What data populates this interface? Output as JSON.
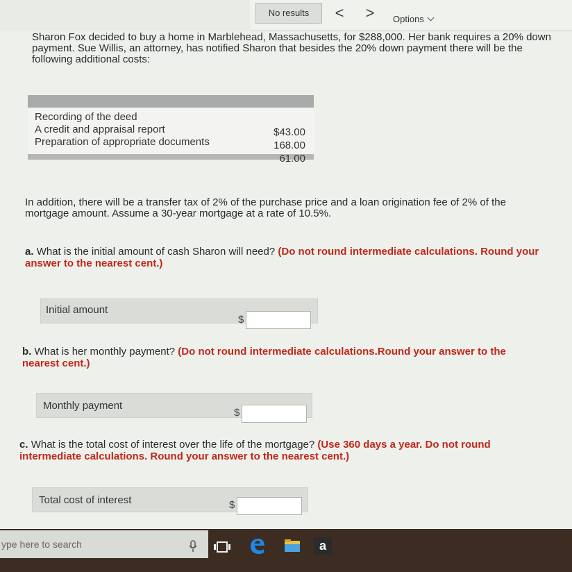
{
  "find_bar": {
    "status": "No results",
    "prev": "<",
    "next": ">",
    "options_label": "Options"
  },
  "problem": {
    "intro": "Sharon Fox decided to buy a home in Marblehead, Massachusetts, for $288,000. Her bank requires a 20% down payment. Sue Willis, an attorney, has notified Sharon that besides the 20% down payment there will be the following additional costs:",
    "costs": [
      {
        "label": "Recording of the deed",
        "value": "$43.00"
      },
      {
        "label": "A credit and appraisal report",
        "value": "168.00"
      },
      {
        "label": "Preparation of appropriate documents",
        "value": "61.00"
      }
    ],
    "additional": "In addition, there will be a transfer tax of 2% of the purchase price and a loan origination fee of 2% of the mortgage amount. Assume a 30-year mortgage at a rate of 10.5%."
  },
  "questions": [
    {
      "letter": "a.",
      "text": "What is the initial amount of cash Sharon will need?",
      "instruction": "(Do not round intermediate calculations. Round your answer to the nearest cent.)",
      "field_label": "Initial amount",
      "currency": "$",
      "value": ""
    },
    {
      "letter": "b.",
      "text": "What is her monthly payment?",
      "instruction": "(Do not round intermediate calculations.Round your answer to the nearest cent.)",
      "field_label": "Monthly payment",
      "currency": "$",
      "value": ""
    },
    {
      "letter": "c.",
      "text": "What is the total cost of interest over the life of the mortgage?",
      "instruction": "(Use 360 days a year. Do not round intermediate calculations. Round your answer to the nearest cent.)",
      "field_label": "Total cost of interest",
      "currency": "$",
      "value": ""
    }
  ],
  "taskbar": {
    "search_placeholder": "ype here to search",
    "amazon_letter": "a"
  },
  "colors": {
    "instruction_red": "#c0281a",
    "taskbar_brown": "#3c2c22",
    "edge_blue": "#1e88e5"
  }
}
